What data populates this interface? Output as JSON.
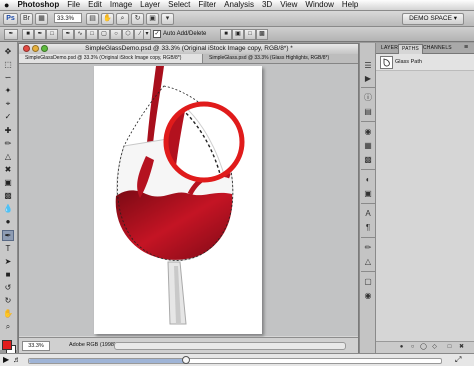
{
  "menubar": {
    "apple": "",
    "items": [
      "Photoshop",
      "File",
      "Edit",
      "Image",
      "Layer",
      "Select",
      "Filter",
      "Analysis",
      "3D",
      "View",
      "Window",
      "Help"
    ]
  },
  "appbar": {
    "zoom": "33.3%",
    "workspace": "DEMO SPACE ▾"
  },
  "options": {
    "auto_add_checked": "✓",
    "auto_add_label": "Auto Add/Delete"
  },
  "document": {
    "window_title": "SimpleGlassDemo.psd @ 33.3% (Original iStock Image copy, RGB/8*) *",
    "tabs": [
      "SimpleGlassDemo.psd @ 33.3% (Original iStock Image copy, RGB/8*)",
      "SimpleGlass.psd @ 33.3% (Glass Highlights, RGB/8*)"
    ],
    "zoom": "33.3%",
    "profile": "Adobe RGB (1998) (8bpc)"
  },
  "panel": {
    "tabs": [
      "LAYERS",
      "PATHS",
      "CHANNELS"
    ],
    "active_tab": "PATHS",
    "paths": [
      {
        "name": "Glass Path"
      }
    ]
  },
  "player": {
    "progress": 0.38
  },
  "colors": {
    "foreground": "#e21b1b",
    "background": "#ffffff",
    "wine": "#b3111e",
    "magnifier_ring": "#e01b1b"
  },
  "icons": {
    "tools": [
      "move-icon",
      "marquee-icon",
      "lasso-icon",
      "quick-select-icon",
      "crop-icon",
      "eyedropper-icon",
      "healing-icon",
      "brush-icon",
      "clone-stamp-icon",
      "history-brush-icon",
      "eraser-icon",
      "gradient-icon",
      "blur-icon",
      "dodge-icon",
      "pen-icon",
      "type-icon",
      "path-select-icon",
      "shape-icon",
      "3d-rotate-icon",
      "3d-orbit-icon",
      "hand-icon",
      "zoom-icon"
    ]
  }
}
